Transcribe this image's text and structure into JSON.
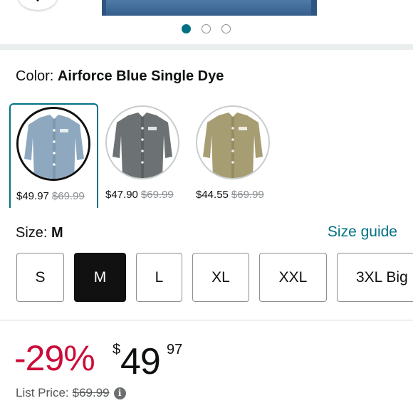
{
  "gallery": {
    "page_count": 3,
    "active_index": 0
  },
  "color": {
    "label": "Color:",
    "selected_name": "Airforce Blue Single Dye"
  },
  "swatches": [
    {
      "price": "$49.97",
      "was": "$69.99",
      "tint": "#8ea9bf",
      "selected": true
    },
    {
      "price": "$47.90",
      "was": "$69.99",
      "tint": "#6c7173",
      "selected": false
    },
    {
      "price": "$44.55",
      "was": "$69.99",
      "tint": "#a79d72",
      "selected": false
    }
  ],
  "size": {
    "label": "Size:",
    "selected": "M",
    "guide_link": "Size guide",
    "options": [
      "S",
      "M",
      "L",
      "XL",
      "XXL",
      "3XL Big"
    ]
  },
  "pricing": {
    "discount": "-29%",
    "currency": "$",
    "whole": "49",
    "fraction": "97",
    "list_label": "List Price:",
    "list_value": "$69.99"
  },
  "colors": {
    "accent": "#007185",
    "discount_red": "#cc0c39",
    "selected_size_bg": "#111111"
  },
  "icons": {
    "favorite": "heart-icon",
    "info": "info-icon"
  }
}
